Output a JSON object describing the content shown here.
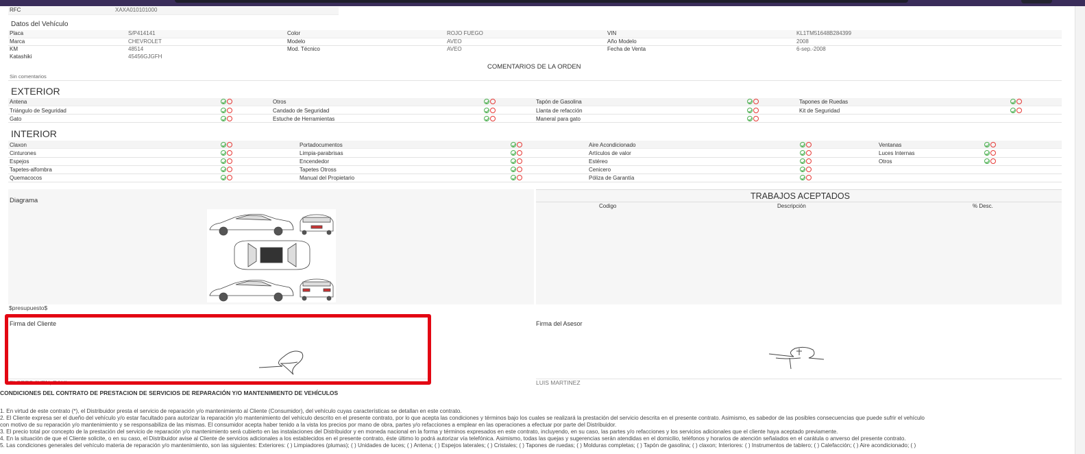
{
  "rfc": {
    "label": "RFC",
    "value": "XAXA010101000"
  },
  "vehicle": {
    "section_title": "Datos del Vehículo",
    "fields": [
      {
        "label": "Placa",
        "value": "S/P414141"
      },
      {
        "label": "Marca",
        "value": "CHEVROLET"
      },
      {
        "label": "KM",
        "value": "48514"
      },
      {
        "label": "Katashiki",
        "value": "45456GJGFH"
      },
      {
        "label": "Color",
        "value": "ROJO FUEGO"
      },
      {
        "label": "Modelo",
        "value": "AVEO"
      },
      {
        "label": "Mod. Técnico",
        "value": "AVEO"
      },
      {
        "label": "VIN",
        "value": "KL1TM51648B284399"
      },
      {
        "label": "Año Modelo",
        "value": "2008"
      },
      {
        "label": "Fecha de Venta",
        "value": "6-sep.-2008"
      }
    ]
  },
  "comments": {
    "title": "COMENTARIOS DE LA ORDEN",
    "text": "Sin comentarios"
  },
  "exterior": {
    "title": "EXTERIOR",
    "items": [
      "Antena",
      "Triángulo de Seguridad",
      "Gato",
      "Otros",
      "Candado de Seguridad",
      "Estuche de Herramientas",
      "Tapón de Gasolina",
      "Llanta de refacción",
      "Maneral para gato",
      "Tapones de Ruedas",
      "Kit de Seguridad"
    ]
  },
  "interior": {
    "title": "INTERIOR",
    "items": [
      "Claxon",
      "Cinturones",
      "Espejos",
      "Tapetes-alfombra",
      "Quemacocos",
      "Portadocumentos",
      "Limpia-parabrisas",
      "Encendedor",
      "Tapetes Otross",
      "Manual del Propietario",
      "Aire Acondicionado",
      "Artículos de valor",
      "Estéreo",
      "Cenicero",
      "Póliza de Garantía",
      "Ventanas",
      "Luces Internas",
      "Otros"
    ]
  },
  "diagram": {
    "title": "Diagrama"
  },
  "trabajos": {
    "title": "TRABAJOS ACEPTADOS",
    "columns": [
      "Codigo",
      "Descripción",
      "% Desc."
    ]
  },
  "presupuesto": "$presupuesto$",
  "signatures": {
    "cliente_label": "Firma del Cliente",
    "cliente_name": "FLORES AVEN, RAUL",
    "asesor_label": "Firma del Asesor",
    "asesor_name": "LUIS MARTINEZ"
  },
  "contract": {
    "title": "CONDICIONES DEL CONTRATO DE PRESTACION DE SERVICIOS DE REPARACIÓN Y/O MANTENIMIENTO DE VEHÍCULOS",
    "lines": [
      "1. En virtud de este contrato (*), el Distribuidor presta el servicio de reparación y/o mantenimiento al Cliente (Consumidor), del vehículo cuyas características se detallan en este contrato.",
      "2. El Cliente expresa ser el dueño del vehículo y/o estar facultado para autorizar la reparación y/o mantenimiento del vehículo descrito en el presente contrato, por lo que acepta las condiciones y términos bajo los cuales se realizará la prestación del servicio descrita en el presente contrato. Asimismo, es sabedor de las posibles consecuencias que puede sufrir el vehículo",
      "con motivo de su reparación y/o mantenimiento y se responsabiliza de las mismas. El consumidor acepta haber tenido a la vista los precios por mano de obra, partes y/o refacciones a emplear en las operaciones a efectuar por parte del Distribuidor.",
      "3. El precio total por concepto de la prestación del servicio de reparación y/o mantenimiento será cubierto en las instalaciones del Distribuidor y en moneda nacional en la forma y términos expresados en este contrato, incluyendo, en su caso, las partes y/o refacciones y los servicios adicionales que el cliente haya aceptado previamente.",
      "4. En la situación de que el Cliente solicite, o en su caso, el Distribuidor avise al Cliente de servicios adicionales a los establecidos en el presente contrato, éste último lo podrá autorizar vía telefónica. Asimismo, todas las quejas y sugerencias serán atendidas en el domicilio, teléfonos y horarios de atención señalados en el carátula o anverso del presente contrato.",
      "5. Las condiciones generales del vehículo materia de reparación y/o mantenimiento, son las siguientes: Exteriores: ( ) Limpiadores (plumas); ( ) Unidades de luces; ( ) Antena; ( ) Espejos laterales; ( ) Cristales; ( ) Tapones de ruedas; ( ) Molduras completas; ( ) Tapón de gasolina; ( ) claxon; Interiores: ( ) Instrumentos de tablero; ( ) Calefacción; ( ) Aire acondicionado; ( )"
    ]
  },
  "colors": {
    "ok": "#4caf50",
    "no": "#e53935",
    "highlight": "#e30613",
    "topbar": "#3a2d5a"
  }
}
